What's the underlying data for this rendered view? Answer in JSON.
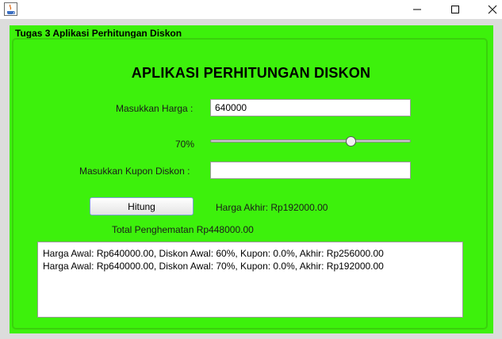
{
  "window": {
    "title": "",
    "controls": [
      "minimize-icon",
      "maximize-icon",
      "close-icon"
    ]
  },
  "panel": {
    "title": "Tugas 3 Aplikasi Perhitungan Diskon",
    "heading": "APLIKASI PERHITUNGAN DISKON",
    "background_color": "#3df10c"
  },
  "form": {
    "price_label": "Masukkan Harga :",
    "price_value": "640000",
    "discount_label": "70%",
    "discount_slider_value": 0.7,
    "coupon_label": "Masukkan Kupon Diskon :",
    "coupon_value": "",
    "calculate_button": "Hitung",
    "final_price": "Harga Akhir: Rp192000.00",
    "total_savings": "Total Penghematan Rp448000.00"
  },
  "history": [
    "Harga Awal: Rp640000.00, Diskon Awal: 60%, Kupon: 0.0%, Akhir: Rp256000.00",
    "Harga Awal: Rp640000.00, Diskon Awal: 70%, Kupon: 0.0%, Akhir: Rp192000.00"
  ]
}
